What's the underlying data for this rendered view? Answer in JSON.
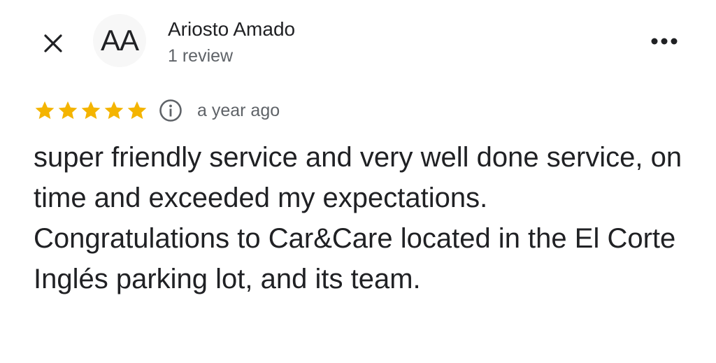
{
  "header": {
    "avatar_initials": "AA",
    "user_name": "Ariosto Amado",
    "user_reviews": "1 review",
    "close_icon": "close-icon",
    "more_icon": "more-horizontal-icon"
  },
  "review": {
    "rating": 5,
    "rating_max": 5,
    "star_color": "#f4b400",
    "info_icon": "info-icon",
    "time_ago": "a year ago",
    "text": "super friendly service and very well done service, on time and exceeded my expectations. Congratulations to Car&Care located in the El Corte Inglés parking lot, and its team."
  }
}
